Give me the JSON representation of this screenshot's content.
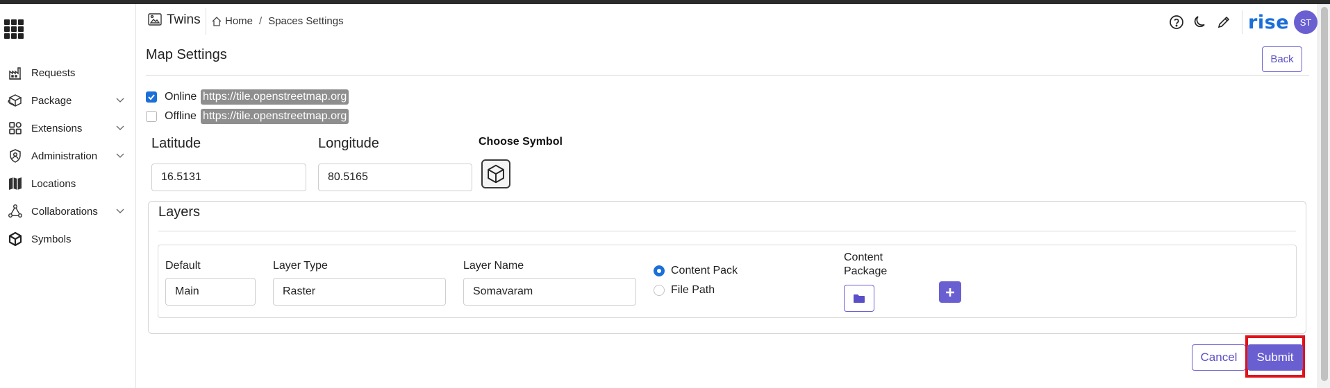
{
  "header": {
    "app_name": "Twins",
    "breadcrumb": {
      "home": "Home",
      "separator": "/",
      "current": "Spaces Settings"
    },
    "icons": [
      "help-icon",
      "moon-icon",
      "pencil-icon"
    ],
    "logo_text": "rise",
    "avatar_initials": "ST"
  },
  "sidebar": {
    "items": [
      {
        "label": "Requests",
        "icon": "requests-icon",
        "expandable": false
      },
      {
        "label": "Package",
        "icon": "package-icon",
        "expandable": true
      },
      {
        "label": "Extensions",
        "icon": "extensions-icon",
        "expandable": true
      },
      {
        "label": "Administration",
        "icon": "shield-user-icon",
        "expandable": true
      },
      {
        "label": "Locations",
        "icon": "map-icon",
        "expandable": false
      },
      {
        "label": "Collaborations",
        "icon": "network-icon",
        "expandable": true
      },
      {
        "label": "Symbols",
        "icon": "cube-icon",
        "expandable": false
      }
    ]
  },
  "page": {
    "title": "Map Settings",
    "back_label": "Back"
  },
  "sources": {
    "online": {
      "label": "Online",
      "url": "https://tile.openstreetmap.org",
      "checked": true
    },
    "offline": {
      "label": "Offline",
      "url": "https://tile.openstreetmap.org",
      "checked": false
    }
  },
  "coordinates": {
    "latitude_label": "Latitude",
    "latitude_value": "16.5131",
    "longitude_label": "Longitude",
    "longitude_value": "80.5165"
  },
  "symbol": {
    "label": "Choose Symbol",
    "icon": "cube-icon"
  },
  "layers": {
    "title": "Layers",
    "default_label": "Default",
    "default_value": "Main",
    "layer_type_label": "Layer Type",
    "layer_type_value": "Raster",
    "layer_name_label": "Layer Name",
    "layer_name_value": "Somavaram",
    "source_options": [
      {
        "label": "Content Pack",
        "selected": true
      },
      {
        "label": "File Path",
        "selected": false
      }
    ],
    "content_package_label_line1": "Content",
    "content_package_label_line2": "Package"
  },
  "footer": {
    "cancel_label": "Cancel",
    "submit_label": "Submit"
  },
  "colors": {
    "accent": "#6a5fd1",
    "checkbox": "#1a6fd8",
    "highlight": "#e0121b",
    "url_chip": "#8e8e8e"
  }
}
